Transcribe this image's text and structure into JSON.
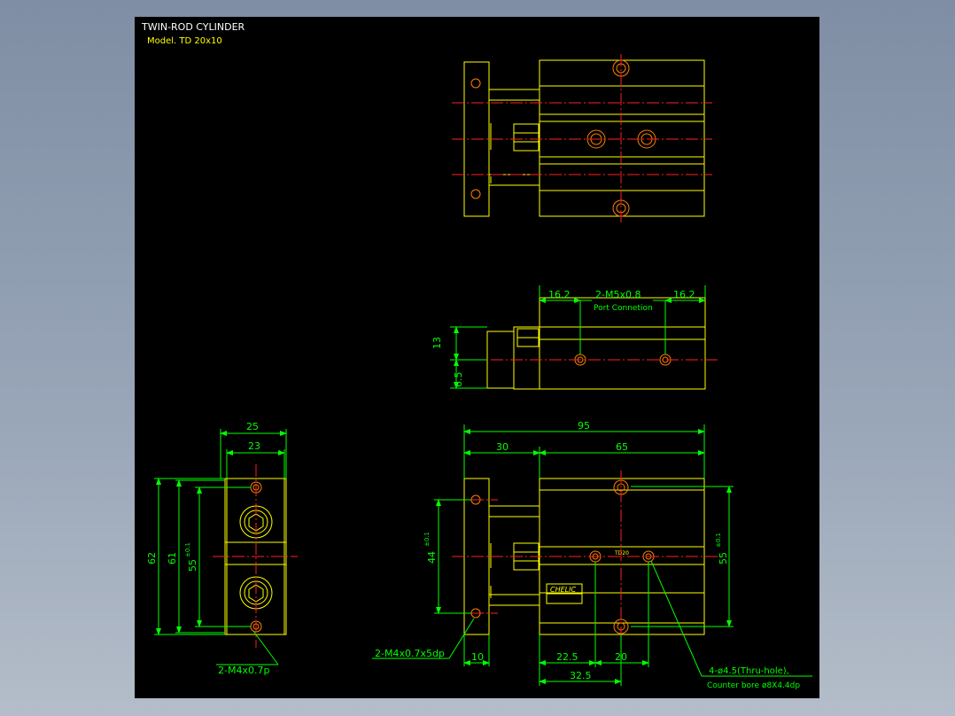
{
  "header": {
    "title": "TWIN-ROD CYLINDER",
    "model": "Model. TD 20x10"
  },
  "side_view": {
    "dim_left": "16.2",
    "dim_right": "16.2",
    "port_label": "2-M5x0.8",
    "port_sub": "Port Connetion",
    "dim_13": "13",
    "dim_6_5": "6.5"
  },
  "end_view": {
    "dim_25": "25",
    "dim_23": "23",
    "dim_62": "62",
    "dim_61": "61",
    "dim_55": "55",
    "tol_55": "±0.1",
    "thread_note": "2-M4x0.7p"
  },
  "plan_view": {
    "dim_95": "95",
    "dim_30": "30",
    "dim_65": "65",
    "dim_44": "44",
    "tol_44": "±0.1",
    "dim_55": "55",
    "tol_55": "±0.1",
    "dim_22_5": "22.5",
    "dim_20": "20",
    "dim_32_5": "32.5",
    "dim_10": "10",
    "plate_note": "2-M4x0.7x5dp",
    "hole_note": "4-ø4.5(Thru-hole),",
    "bore_note": "Counter bore ø8X4.4dp",
    "body_tag": "TD20",
    "brand": "CHELIC"
  },
  "colors": {
    "outline": "#ffff00",
    "dimension": "#00ff00",
    "centerline": "#ff0000",
    "hole": "#ff7f00",
    "sheet": "#000000"
  }
}
